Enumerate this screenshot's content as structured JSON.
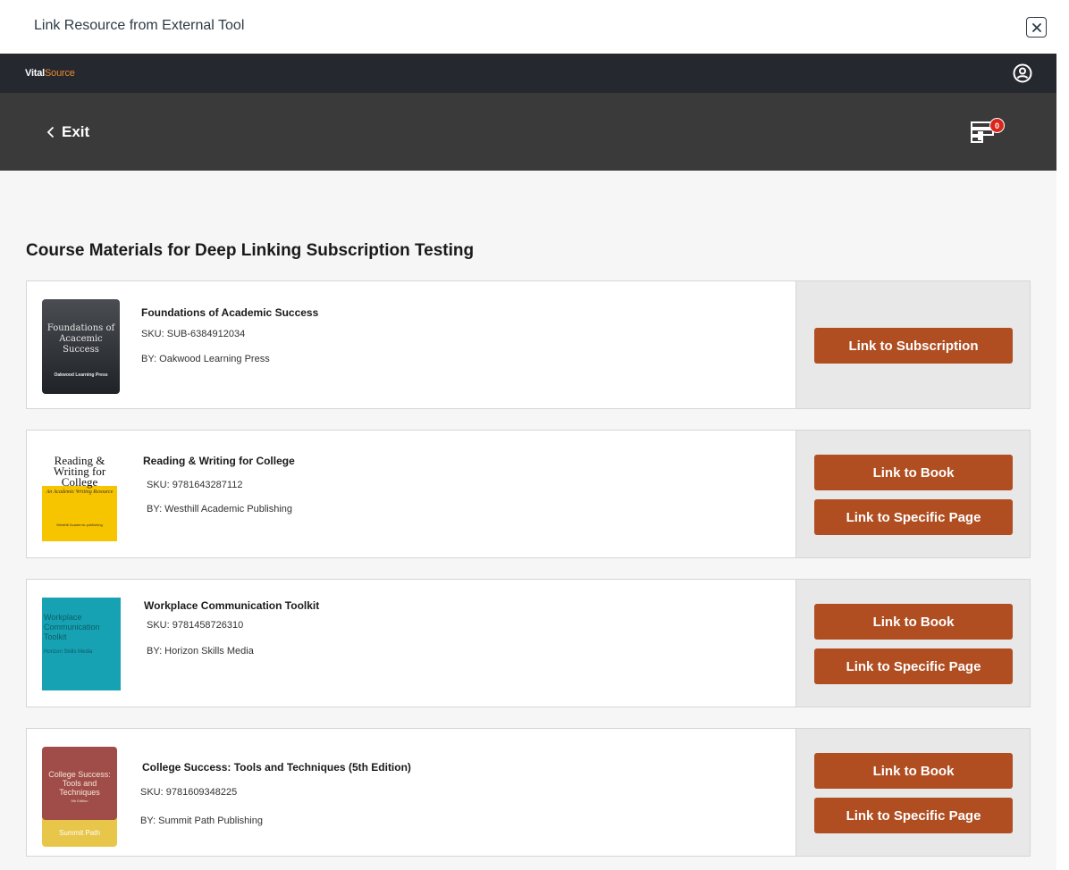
{
  "dialog": {
    "title": "Link Resource from External Tool",
    "close_icon": "close-icon"
  },
  "brand": {
    "name_bold": "Vital",
    "name_light": "Source"
  },
  "nav": {
    "exit_label": "Exit",
    "cart_count": "0"
  },
  "section_title": "Course Materials for Deep Linking Subscription Testing",
  "colors": {
    "button": "#b04e22",
    "header_bar": "#262830",
    "nav_bar": "#3a3a3a"
  },
  "items": [
    {
      "title": "Foundations of Academic Success",
      "sku": "SKU: SUB-6384912034",
      "by": "BY: Oakwood Learning Press",
      "cover": {
        "title": "Foundations of Acacemic Success",
        "publisher": "Oakwood Learning Press"
      },
      "actions": [
        "Link to Subscription"
      ]
    },
    {
      "title": "Reading & Writing for College",
      "sku": "SKU: 9781643287112",
      "by": "BY: Westhill Academic Publishing",
      "cover": {
        "title": "Reading & Writing for College",
        "subtitle": "An Academic Writing Resource",
        "publisher": "Westhill Academic publishing"
      },
      "actions": [
        "Link to Book",
        "Link to Specific Page"
      ]
    },
    {
      "title": "Workplace Communication Toolkit",
      "sku": "SKU: 9781458726310",
      "by": "BY: Horizon Skills Media",
      "cover": {
        "title": "Workplace Communication Toolkit",
        "publisher": "Horizon Skills Media"
      },
      "actions": [
        "Link to Book",
        "Link to Specific Page"
      ]
    },
    {
      "title": "College Success: Tools and Techniques (5th Edition)",
      "sku": "SKU: 9781609348225",
      "by": "BY: Summit Path Publishing",
      "cover": {
        "title": "College Success: Tools and Techniques",
        "edition": "5th Edition",
        "publisher": "Summit Path"
      },
      "actions": [
        "Link to Book",
        "Link to Specific Page"
      ]
    }
  ]
}
